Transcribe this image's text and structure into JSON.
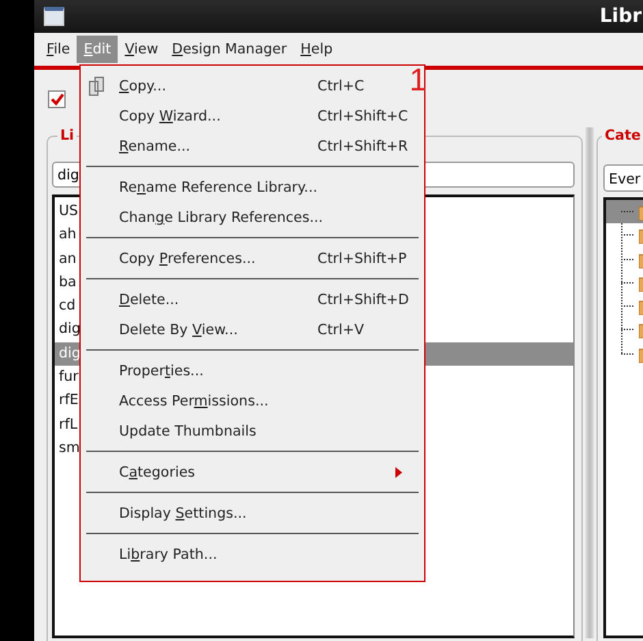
{
  "window": {
    "title": "Libr"
  },
  "menubar": [
    {
      "key": "F",
      "after": "ile",
      "selected": false
    },
    {
      "key": "E",
      "after": "dit",
      "selected": true
    },
    {
      "key": "V",
      "after": "iew",
      "selected": false
    },
    {
      "key": "D",
      "after": "esign Manager",
      "selected": false
    },
    {
      "key": "H",
      "after": "elp",
      "selected": false
    }
  ],
  "toolbar": {
    "checkbox": {
      "checked": true
    }
  },
  "library_panel": {
    "title": "Li",
    "filter": {
      "value": "dig"
    },
    "items": [
      {
        "label": "US",
        "selected": false
      },
      {
        "label": "ah",
        "selected": false
      },
      {
        "label": "an",
        "selected": false
      },
      {
        "label": "ba",
        "selected": false
      },
      {
        "label": "cd",
        "selected": false
      },
      {
        "label": "dig",
        "selected": false
      },
      {
        "label": "dig",
        "selected": true
      },
      {
        "label": "fur",
        "selected": false
      },
      {
        "label": "rfE",
        "selected": false
      },
      {
        "label": "rfL",
        "selected": false
      },
      {
        "label": "sm",
        "selected": false
      }
    ]
  },
  "category_panel": {
    "title": "Cate",
    "filter": {
      "value": "Ever"
    },
    "tree": [
      {
        "selected": true
      },
      {
        "selected": false
      },
      {
        "selected": false
      },
      {
        "selected": false
      },
      {
        "selected": false
      },
      {
        "selected": false
      },
      {
        "selected": false
      }
    ]
  },
  "edit_menu": {
    "annotation": "1",
    "items": [
      {
        "kind": "icon_item",
        "key": "C",
        "after": "opy...",
        "shortcut": "Ctrl+C"
      },
      {
        "kind": "item",
        "before": "Copy ",
        "key": "W",
        "after": "izard...",
        "shortcut": "Ctrl+Shift+C"
      },
      {
        "kind": "item",
        "key": "R",
        "after": "ename...",
        "shortcut": "Ctrl+Shift+R"
      },
      {
        "kind": "separator"
      },
      {
        "kind": "item",
        "before": "Re",
        "key": "n",
        "after": "ame Reference Library..."
      },
      {
        "kind": "item",
        "before": "Chan",
        "key": "g",
        "after": "e Library References..."
      },
      {
        "kind": "separator"
      },
      {
        "kind": "item",
        "before": "Copy ",
        "key": "P",
        "after": "references...",
        "shortcut": "Ctrl+Shift+P"
      },
      {
        "kind": "separator"
      },
      {
        "kind": "item",
        "key": "D",
        "after": "elete...",
        "shortcut": "Ctrl+Shift+D"
      },
      {
        "kind": "item",
        "before": "Delete By ",
        "key": "V",
        "after": "iew...",
        "shortcut": "Ctrl+V"
      },
      {
        "kind": "separator"
      },
      {
        "kind": "item",
        "before": "Proper",
        "key": "t",
        "after": "ies..."
      },
      {
        "kind": "item",
        "before": "Access Per",
        "key": "m",
        "after": "issions..."
      },
      {
        "kind": "item",
        "before": "Update Thumbnails"
      },
      {
        "kind": "separator"
      },
      {
        "kind": "submenu",
        "before": "C",
        "key": "a",
        "after": "tegories"
      },
      {
        "kind": "separator"
      },
      {
        "kind": "item",
        "before": "Display ",
        "key": "S",
        "after": "ettings..."
      },
      {
        "kind": "separator"
      },
      {
        "kind": "item",
        "before": "Li",
        "key": "b",
        "after": "rary Path..."
      }
    ]
  }
}
